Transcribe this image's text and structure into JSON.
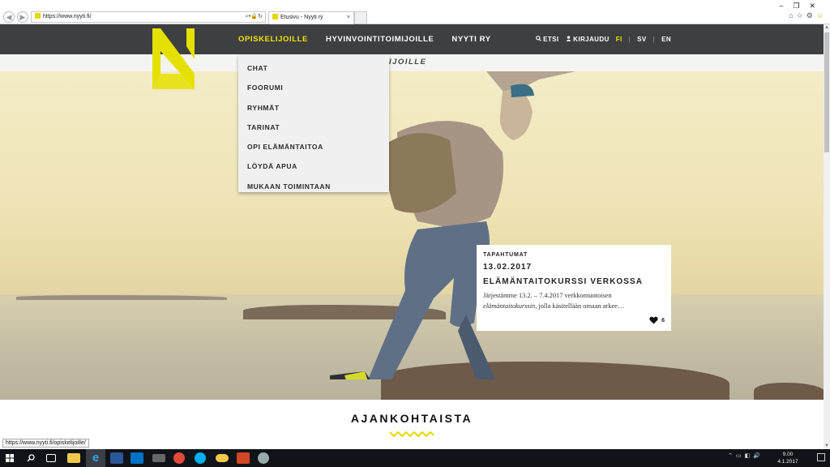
{
  "browser": {
    "url": "https://www.nyyti.fi/",
    "tab_title": "Etusivu - Nyyti ry",
    "tab_close": "×",
    "window_controls": "–❐✕",
    "address_icons": "⌕▾🔒↻"
  },
  "header": {
    "nav": [
      {
        "label": "OPISKELIJOILLE",
        "active": true
      },
      {
        "label": "HYVINVOINTITOIMIJOILLE",
        "active": false
      },
      {
        "label": "NYYTI RY",
        "active": false
      }
    ],
    "search_label": "ETSI",
    "login_label": "KIRJAUDU",
    "languages": [
      "FI",
      "SV",
      "EN"
    ],
    "lang_sep": "|"
  },
  "subheader": {
    "title": "IJOILLE"
  },
  "dropdown": {
    "items": [
      "CHAT",
      "FOORUMI",
      "RYHMÄT",
      "TARINAT",
      "OPI ELÄMÄNTAITOA",
      "LÖYDÄ APUA",
      "MUKAAN TOIMINTAAN"
    ]
  },
  "event_card": {
    "category": "TAPAHTUMAT",
    "date": "13.02.2017",
    "title": "ELÄMÄNTAITOKURSSI VERKOSSA",
    "excerpt_line1": "Järjestämme 13.2. – 7.4.2017 verkkomuotoisen",
    "excerpt_em": "elämäntaitokurssin",
    "excerpt_line2": ", jolla käsitellään omaan arkee…",
    "likes": "6"
  },
  "section": {
    "heading": "AJANKOHTAISTA"
  },
  "status_tooltip": "https://www.nyyti.fi/opiskelijoille/",
  "taskbar": {
    "time": "9.00",
    "date": "4.1.2017",
    "icons": [
      {
        "name": "windows-start-icon",
        "color": "#ffffff"
      },
      {
        "name": "search-icon",
        "color": "#ffffff"
      },
      {
        "name": "task-view-icon",
        "color": "#ffffff"
      },
      {
        "name": "file-explorer-icon",
        "color": "#f2c94c"
      },
      {
        "name": "internet-explorer-icon",
        "color": "#3aa0e8"
      },
      {
        "name": "word-icon",
        "color": "#2b5797"
      },
      {
        "name": "outlook-icon",
        "color": "#0072c6"
      },
      {
        "name": "game-icon",
        "color": "#888888"
      },
      {
        "name": "chrome-icon",
        "color": "#e04b3b"
      },
      {
        "name": "skype-icon",
        "color": "#00aff0"
      },
      {
        "name": "cloud-icon",
        "color": "#f2c94c"
      },
      {
        "name": "powerpoint-icon",
        "color": "#d24726"
      },
      {
        "name": "network-icon",
        "color": "#cccccc"
      }
    ]
  },
  "colors": {
    "accent": "#f0e400",
    "header_bg": "#3e3f41"
  }
}
